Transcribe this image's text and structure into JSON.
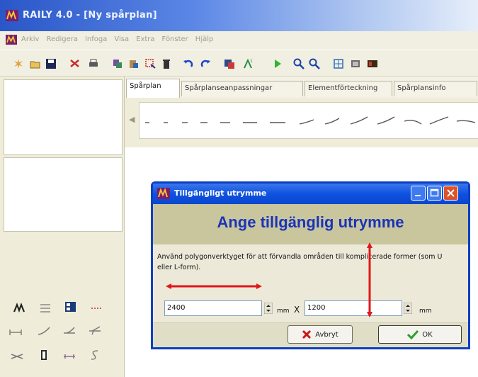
{
  "window": {
    "title": "RAILY 4.0 - [Ny spårplan]"
  },
  "menu": {
    "items": [
      "Arkiv",
      "Redigera",
      "Infoga",
      "Visa",
      "Extra",
      "Fönster",
      "Hjälp"
    ]
  },
  "toolbar": {
    "icons": [
      "new-icon",
      "open-icon",
      "save-icon",
      "cut-icon",
      "print-icon",
      "copy-icon",
      "paste-icon",
      "select-icon",
      "delete-icon",
      "undo-icon",
      "redo-icon",
      "layers-icon",
      "text-icon",
      "play-icon",
      "zoom-in-icon",
      "zoom-out-icon",
      "fit-icon",
      "view-icon",
      "color-icon"
    ]
  },
  "tabs": [
    "Spårplan",
    "Spårplanseanpassningar",
    "Elementförteckning",
    "Spårplansinfo"
  ],
  "dialog": {
    "title": "Tillgängligt utrymme",
    "heading": "Ange tillgänglig utrymme",
    "instruction": "Använd polygonverktyget för att förvandla områden till komplicerade former (som U eller L-form).",
    "width_value": "2400",
    "height_value": "1200",
    "unit": "mm",
    "times": "X",
    "cancel_label": "Avbryt",
    "ok_label": "OK"
  },
  "colors": {
    "title_blue": "#2a56c8",
    "dialog_border": "#0a3fc4",
    "heading_text": "#1a34b8",
    "heading_band": "#c9c69e",
    "annotation_arrow": "#e01818",
    "ok_check": "#2aa02a",
    "cancel_x": "#c81818"
  }
}
